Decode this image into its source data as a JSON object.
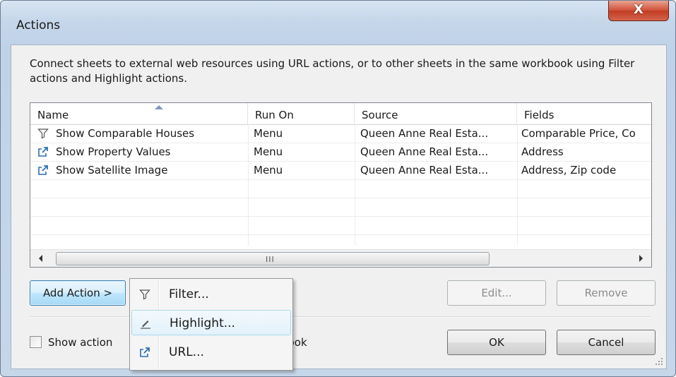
{
  "window": {
    "title": "Actions",
    "close_label": "X"
  },
  "description": "Connect sheets to external web resources using URL actions, or to other sheets in the same workbook using Filter actions and Highlight actions.",
  "table": {
    "columns": [
      "Name",
      "Run On",
      "Source",
      "Fields"
    ],
    "sorted_column": "Name",
    "rows": [
      {
        "icon": "filter-icon",
        "name": "Show Comparable Houses",
        "run_on": "Menu",
        "source": "Queen Anne Real Esta...",
        "fields": "Comparable Price, Co"
      },
      {
        "icon": "url-link-icon",
        "name": "Show Property Values",
        "run_on": "Menu",
        "source": "Queen Anne Real Esta...",
        "fields": "Address"
      },
      {
        "icon": "url-link-icon",
        "name": "Show Satellite Image",
        "run_on": "Menu",
        "source": "Queen Anne Real Esta...",
        "fields": "Address, Zip code"
      }
    ],
    "scrollbar_grip": "III"
  },
  "buttons": {
    "add_action": "Add Action >",
    "edit": "Edit...",
    "remove": "Remove",
    "ok": "OK",
    "cancel": "Cancel"
  },
  "checkbox": {
    "label_visible_left": "Show action",
    "label_visible_right": "kbook",
    "checked": false
  },
  "menu": {
    "items": [
      {
        "icon": "filter-icon",
        "label": "Filter..."
      },
      {
        "icon": "highlight-pen-icon",
        "label": "Highlight..."
      },
      {
        "icon": "url-link-icon",
        "label": "URL..."
      }
    ],
    "hovered_item": "Highlight..."
  },
  "colors": {
    "icon_blue": "#2a6fb5",
    "menu_hover": "#e3f2fb",
    "close_red": "#c23c22"
  }
}
